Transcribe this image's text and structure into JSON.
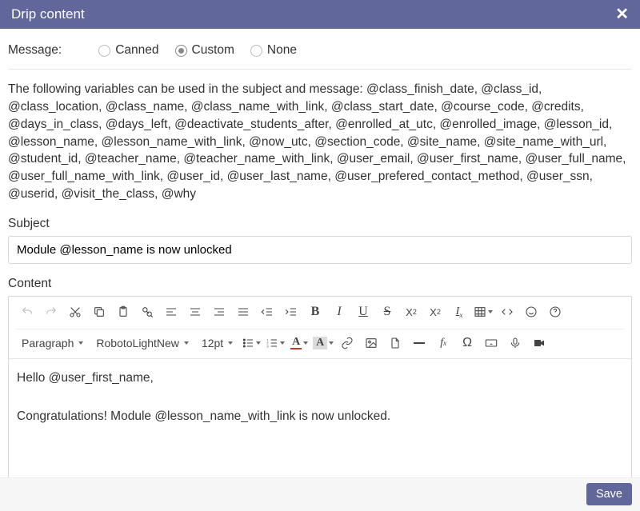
{
  "modal": {
    "title": "Drip content"
  },
  "message": {
    "label": "Message:",
    "options": [
      "Canned",
      "Custom",
      "None"
    ],
    "selected": "Custom"
  },
  "help_text": "The following variables can be used in the subject and message: @class_finish_date, @class_id, @class_location, @class_name, @class_name_with_link, @class_start_date, @course_code, @credits, @days_in_class, @days_left, @deactivate_students_after, @enrolled_at_utc, @enrolled_image, @lesson_id, @lesson_name, @lesson_name_with_link, @now_utc, @section_code, @site_name, @site_name_with_url, @student_id, @teacher_name, @teacher_name_with_link, @user_email, @user_first_name, @user_full_name, @user_full_name_with_link, @user_id, @user_last_name, @user_prefered_contact_method, @user_ssn, @userid, @visit_the_class, @why",
  "subject": {
    "label": "Subject",
    "value": "Module @lesson_name is now unlocked"
  },
  "content": {
    "label": "Content"
  },
  "toolbar": {
    "paragraph": "Paragraph",
    "font": "RobotoLightNew",
    "size": "12pt"
  },
  "body_lines": {
    "l1": "Hello @user_first_name,",
    "l2": "Congratulations! Module @lesson_name_with_link is now unlocked."
  },
  "footer": {
    "save": "Save"
  }
}
